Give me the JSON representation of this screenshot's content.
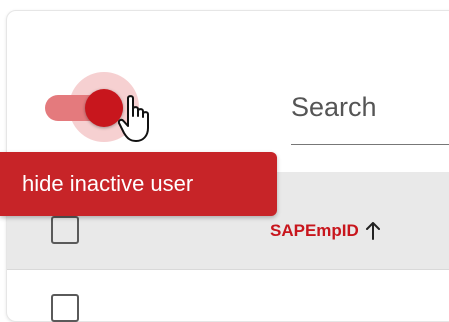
{
  "toolbar": {
    "toggle_state": "on",
    "search_placeholder": "Search"
  },
  "tooltip": {
    "text": "hide inactive user"
  },
  "table": {
    "columns": [
      {
        "label": "SAPEmpID",
        "sort": "ascending",
        "sort_icon": "arrow-up-icon"
      }
    ]
  },
  "colors": {
    "accent": "#c8161d",
    "toggle_track": "#e47a7d",
    "tooltip_bg": "#c72428",
    "header_bg": "#e9e9e9"
  }
}
